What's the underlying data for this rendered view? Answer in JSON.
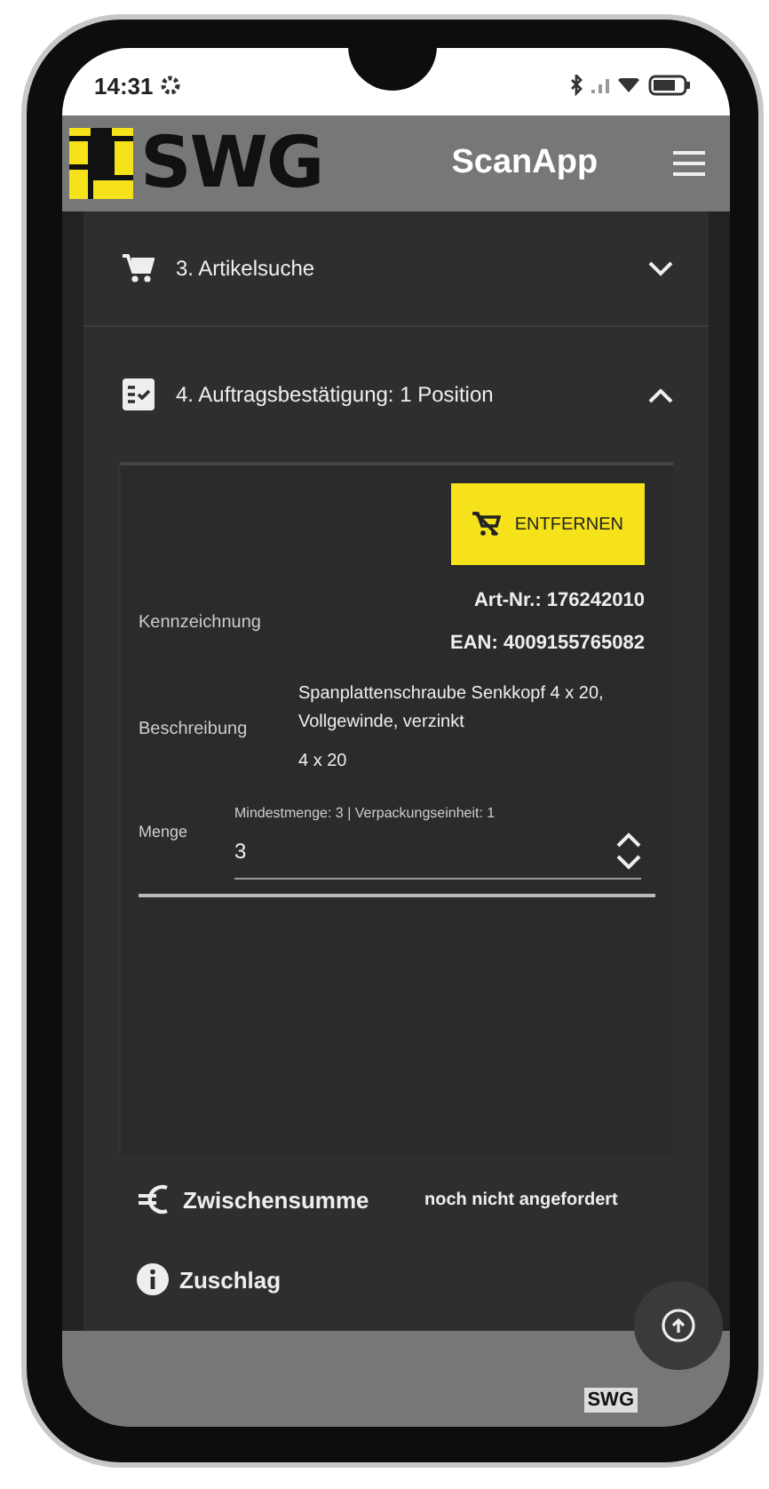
{
  "status_bar": {
    "time": "14:31"
  },
  "header": {
    "logo_text": "SWG",
    "title": "ScanApp"
  },
  "sections": [
    {
      "kind": "cart",
      "title": "3. Artikelsuche",
      "expanded": false
    },
    {
      "kind": "checklist",
      "title": "4. Auftragsbestätigung: 1 Position",
      "expanded": true
    }
  ],
  "item": {
    "remove_button": "ENTFERNEN",
    "fields": [
      {
        "label": "Kennzeichnung",
        "values": [
          "Art-Nr.: 176242010",
          "EAN: 4009155765082"
        ],
        "bold": true
      },
      {
        "label": "Beschreibung",
        "values": [
          "Spanplattenschraube Senkkopf 4 x 20, Vollgewinde, verzinkt",
          "4 x 20"
        ],
        "bold": false
      }
    ],
    "quantity": {
      "label": "Menge",
      "hint": "Mindestmenge: 3 | Verpackungseinheit: 1",
      "value": "3"
    }
  },
  "summary": [
    {
      "kind": "euro",
      "label": "Zwischensumme",
      "value": "noch nicht angefordert"
    },
    {
      "kind": "info",
      "label": "Zuschlag"
    }
  ],
  "footer": {
    "brand": "SWG"
  }
}
